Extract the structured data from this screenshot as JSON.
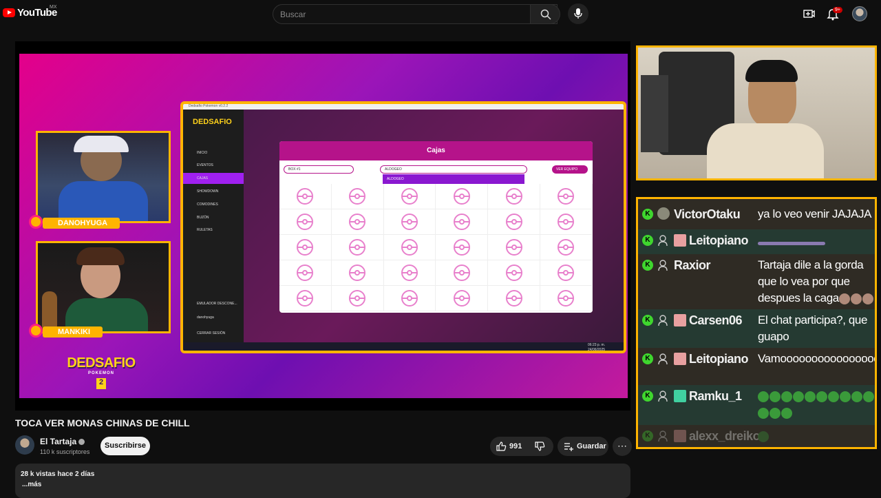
{
  "header": {
    "brand": "YouTube",
    "region": "MX",
    "search_placeholder": "Buscar",
    "notification_count": "9+",
    "icons": [
      "search-icon",
      "mic-icon",
      "create-icon",
      "bell-icon",
      "avatar"
    ]
  },
  "stream": {
    "cam_labels": [
      "DANOHYUGA",
      "MANKIKI"
    ],
    "logo_line1": "DEDSAFIO",
    "logo_line2": "POKEMON",
    "logo_line3": "2",
    "game": {
      "window_title": "Dedsafio Pokemon v0.2.2",
      "side_logo": "DEDSAFIO",
      "menu": [
        "INICIO",
        "EVENTOS",
        "CAJAS",
        "SHOWDOWN",
        "COMODINES",
        "BUZÓN",
        "RULETAS"
      ],
      "bottom_items": [
        "EMULADOR DESCONE...",
        "danohyuga",
        "CERRAR SESIÓN"
      ],
      "panel_title": "Cajas",
      "box_select": "BOX #1",
      "user_select": "ALDOGEO",
      "dropdown_option": "ALDOGEO",
      "team_button": "VER EQUIPO",
      "clock": "06:23 p. m.",
      "date": "24/06/2025"
    }
  },
  "chat": {
    "messages": [
      {
        "user": "VictorOtaku",
        "text": "ya lo veo venir JAJAJA",
        "emotes": 0
      },
      {
        "user": "Leitopiano",
        "text": "",
        "emotes": 0
      },
      {
        "user": "Raxior",
        "text": "Tartaja dile a la gorda que lo vea por que despues la caga",
        "emotes": 3
      },
      {
        "user": "Carsen06",
        "text": "El chat participa?, que guapo",
        "emotes": 0
      },
      {
        "user": "Leitopiano",
        "text": "Vamoooooooooooooooooooooooos",
        "emotes": 0
      },
      {
        "user": "Ramku_1",
        "text": "",
        "emotes": 13
      },
      {
        "user": "alexx_dreiko",
        "text": "",
        "emotes": 1
      }
    ]
  },
  "video": {
    "title": "TOCA VER MONAS CHINAS DE CHILL",
    "channel_name": "El Tartaja",
    "subscribers": "110 k suscriptores",
    "subscribe_label": "Suscribirse",
    "likes": "991",
    "save_label": "Guardar",
    "stats": "28 k vistas  hace 2 días",
    "more_label": "...más"
  },
  "colors": {
    "background": "#0f0f0f",
    "accent_yellow": "#ffb400",
    "brand_red": "#ff0000",
    "panel_magenta": "#b5138a"
  }
}
